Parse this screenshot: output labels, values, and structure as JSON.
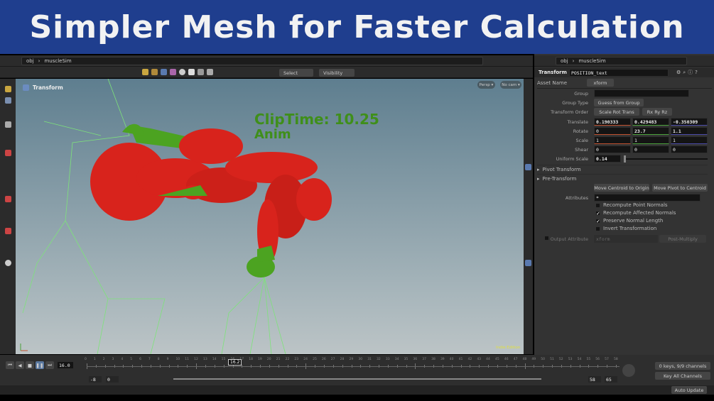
{
  "banner": {
    "title": "Simpler Mesh for Faster Calculation"
  },
  "left_pane": {
    "path": [
      "obj",
      "muscleSim"
    ],
    "toolbar": {
      "select": "Select",
      "visibility": "Visibility"
    },
    "viewport": {
      "node_label": "Transform",
      "persp": "Persp ▾",
      "camera": "No cam ▾",
      "overlay_line1": "ClipTime: 10.25",
      "overlay_line2": "Anim",
      "edition": "Indie Edition"
    }
  },
  "right_pane": {
    "path": [
      "obj",
      "muscleSim"
    ],
    "node_type": "Transform",
    "node_name": "POSITION_text",
    "asset_name_label": "Asset Name",
    "asset_name": "xform",
    "params": {
      "group_label": "Group",
      "group_value": "",
      "group_type_label": "Group Type",
      "group_type": "Guess from Group",
      "transform_order_label": "Transform Order",
      "transform_order": "Scale Rot Trans",
      "rot_order": "Rx Ry Rz",
      "translate_label": "Translate",
      "translate": [
        "0.190333",
        "0.429483",
        "-0.350309"
      ],
      "rotate_label": "Rotate",
      "rotate": [
        "0",
        "23.7",
        "1.1"
      ],
      "scale_label": "Scale",
      "scale": [
        "1",
        "1",
        "1"
      ],
      "shear_label": "Shear",
      "shear": [
        "0",
        "0",
        "0"
      ],
      "uniform_scale_label": "Uniform Scale",
      "uniform_scale": "0.14",
      "pivot_transform": "Pivot Transform",
      "pre_transform": "Pre-Transform",
      "move_centroid": "Move Centroid to Origin",
      "move_pivot": "Move Pivot to Centroid",
      "attributes_label": "Attributes",
      "attributes": "*",
      "checkboxes": [
        {
          "label": "Recompute Point Normals",
          "checked": false
        },
        {
          "label": "Recompute Affected Normals",
          "checked": true
        },
        {
          "label": "Preserve Normal Length",
          "checked": true
        },
        {
          "label": "Invert Transformation",
          "checked": false
        }
      ],
      "output_attribute_label": "Output Attribute",
      "output_attribute": "xform",
      "output_mode": "Post-Multiply"
    }
  },
  "timeline": {
    "current_frame": "16.0",
    "frame_marker": "16.2",
    "start": "-8",
    "start2": "0",
    "end": "58",
    "end2": "65",
    "keys_info": "0 keys, 9/9 channels",
    "key_all": "Key All Channels",
    "auto_update": "Auto Update",
    "tick_labels": [
      "0",
      "1",
      "2",
      "3",
      "4",
      "5",
      "6",
      "7",
      "8",
      "9",
      "10",
      "11",
      "12",
      "13",
      "14",
      "15",
      "16",
      "17",
      "18",
      "19",
      "20",
      "21",
      "22",
      "23",
      "24",
      "25",
      "26",
      "27",
      "28",
      "29",
      "30",
      "31",
      "32",
      "33",
      "34",
      "35",
      "36",
      "37",
      "38",
      "39",
      "40",
      "41",
      "42",
      "43",
      "44",
      "45",
      "46",
      "47",
      "48",
      "49",
      "50",
      "51",
      "52",
      "53",
      "54",
      "55",
      "56",
      "57",
      "58"
    ]
  },
  "colors": {
    "banner": "#1f3e8e",
    "mesh_red": "#d8231c",
    "mesh_green": "#4ca321",
    "overlay_text": "#3f8f1a",
    "x_axis": "#c0502e",
    "y_axis": "#4aa03a",
    "z_axis": "#4a4aa8"
  }
}
